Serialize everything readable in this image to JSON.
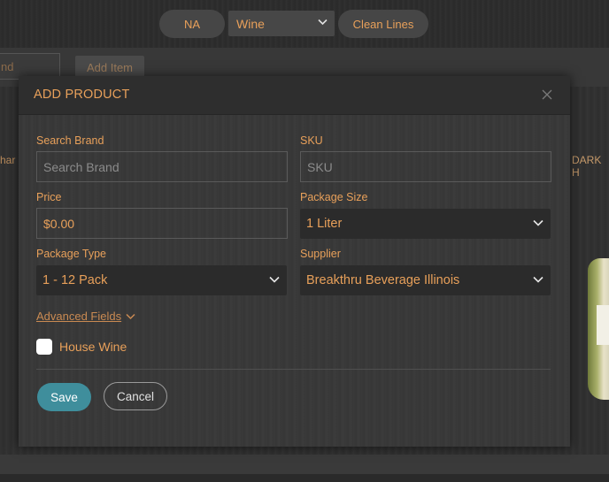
{
  "topbar": {
    "pill_left": "NA",
    "category_select": "Wine",
    "pill_right": "Clean Lines"
  },
  "background": {
    "brand_input_text": "nd",
    "add_item_label": "Add Item",
    "left_card_text": "har",
    "right_card_text": "DARK H"
  },
  "modal": {
    "title": "ADD PRODUCT",
    "fields": {
      "brand": {
        "label": "Search Brand",
        "placeholder": "Search Brand"
      },
      "sku": {
        "label": "SKU",
        "placeholder": "SKU"
      },
      "price": {
        "label": "Price",
        "value": "$0.00"
      },
      "package_size": {
        "label": "Package Size",
        "value": "1 Liter"
      },
      "package_type": {
        "label": "Package Type",
        "value": "1 - 12 Pack"
      },
      "supplier": {
        "label": "Supplier",
        "value": "Breakthru Beverage Illinois"
      }
    },
    "advanced_fields_label": "Advanced Fields",
    "house_wine_label": "House Wine",
    "house_wine_checked": false,
    "save_label": "Save",
    "cancel_label": "Cancel"
  },
  "colors": {
    "accent": "#e8a05a",
    "save_button": "#3f8e9c"
  }
}
